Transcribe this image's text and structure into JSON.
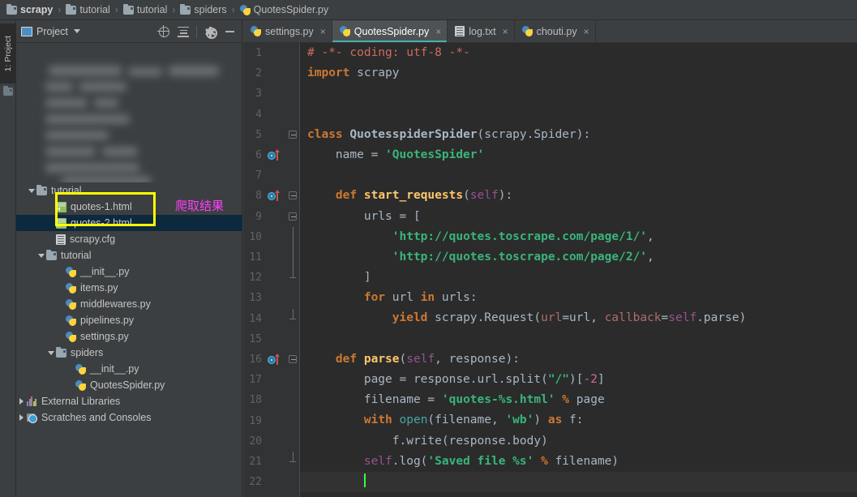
{
  "breadcrumb": [
    {
      "label": "scrapy",
      "icon": "folder-icon"
    },
    {
      "label": "tutorial",
      "icon": "folder-icon"
    },
    {
      "label": "tutorial",
      "icon": "folder-icon"
    },
    {
      "label": "spiders",
      "icon": "folder-icon"
    },
    {
      "label": "QuotesSpider.py",
      "icon": "python-file-icon"
    }
  ],
  "breadcrumb_separator": "›",
  "tool_strip": {
    "project_button": "1: Project"
  },
  "project_panel": {
    "title": "Project",
    "actions": {
      "locate": "select-opened-file",
      "collapse": "collapse-all",
      "settings": "settings",
      "minimize": "hide"
    },
    "tree": [
      {
        "label": "tutorial",
        "icon": "folder-icon",
        "indent": 1,
        "twisty": "down",
        "selected": false
      },
      {
        "label": "quotes-1.html",
        "icon": "html-file-icon",
        "indent": 3,
        "twisty": "none",
        "selected": false
      },
      {
        "label": "quotes-2.html",
        "icon": "html-file-icon",
        "indent": 3,
        "twisty": "none",
        "selected": true
      },
      {
        "label": "scrapy.cfg",
        "icon": "text-file-icon",
        "indent": 3,
        "twisty": "none",
        "selected": false
      },
      {
        "label": "tutorial",
        "icon": "folder-icon",
        "indent": 2,
        "twisty": "down",
        "selected": false
      },
      {
        "label": "__init__.py",
        "icon": "python-file-icon",
        "indent": 4,
        "twisty": "none",
        "selected": false
      },
      {
        "label": "items.py",
        "icon": "python-file-icon",
        "indent": 4,
        "twisty": "none",
        "selected": false
      },
      {
        "label": "middlewares.py",
        "icon": "python-file-icon",
        "indent": 4,
        "twisty": "none",
        "selected": false
      },
      {
        "label": "pipelines.py",
        "icon": "python-file-icon",
        "indent": 4,
        "twisty": "none",
        "selected": false
      },
      {
        "label": "settings.py",
        "icon": "python-file-icon",
        "indent": 4,
        "twisty": "none",
        "selected": false
      },
      {
        "label": "spiders",
        "icon": "folder-icon",
        "indent": 3,
        "twisty": "down",
        "selected": false
      },
      {
        "label": "__init__.py",
        "icon": "python-file-icon",
        "indent": 5,
        "twisty": "none",
        "selected": false
      },
      {
        "label": "QuotesSpider.py",
        "icon": "python-file-icon",
        "indent": 5,
        "twisty": "none",
        "selected": false
      },
      {
        "label": "External Libraries",
        "icon": "library-icon",
        "indent": 0,
        "twisty": "right",
        "selected": false
      },
      {
        "label": "Scratches and Consoles",
        "icon": "scratches-icon",
        "indent": 0,
        "twisty": "right",
        "selected": false
      }
    ],
    "annotation": {
      "text": "爬取结果",
      "box_color": "#ffff00",
      "text_color": "#ff3fff"
    }
  },
  "editor": {
    "tabs": [
      {
        "label": "settings.py",
        "icon": "python-file-icon",
        "active": false,
        "close": "×"
      },
      {
        "label": "QuotesSpider.py",
        "icon": "python-file-icon",
        "active": true,
        "close": "×"
      },
      {
        "label": "log.txt",
        "icon": "text-file-icon",
        "active": false,
        "close": "×"
      },
      {
        "label": "chouti.py",
        "icon": "python-file-icon",
        "active": false,
        "close": "×"
      }
    ],
    "active_tab_underline_color": "#46b0b0",
    "caret_color": "#3aff3a",
    "lines": [
      {
        "num": "1",
        "gutter_run": false,
        "fold": "none",
        "tokens": [
          {
            "t": "comment",
            "v": "# -*- coding: utf-8 -*-"
          }
        ]
      },
      {
        "num": "2",
        "gutter_run": false,
        "fold": "none",
        "tokens": [
          {
            "t": "kw",
            "v": "import"
          },
          {
            "t": "plain",
            "v": " scrapy"
          }
        ]
      },
      {
        "num": "3",
        "gutter_run": false,
        "fold": "none",
        "tokens": []
      },
      {
        "num": "4",
        "gutter_run": false,
        "fold": "none",
        "tokens": []
      },
      {
        "num": "5",
        "gutter_run": false,
        "fold": "minus",
        "tokens": [
          {
            "t": "kw",
            "v": "class"
          },
          {
            "t": "plain",
            "v": " "
          },
          {
            "t": "class",
            "v": "QuotesspiderSpider"
          },
          {
            "t": "op",
            "v": "("
          },
          {
            "t": "plain",
            "v": "scrapy.Spider"
          },
          {
            "t": "op",
            "v": "):"
          }
        ]
      },
      {
        "num": "6",
        "gutter_run": true,
        "fold": "none",
        "tokens": [
          {
            "t": "plain",
            "v": "    name = "
          },
          {
            "t": "str",
            "v": "'QuotesSpider'"
          }
        ]
      },
      {
        "num": "7",
        "gutter_run": false,
        "fold": "none",
        "tokens": []
      },
      {
        "num": "8",
        "gutter_run": true,
        "fold": "minus",
        "tokens": [
          {
            "t": "plain",
            "v": "    "
          },
          {
            "t": "kw",
            "v": "def"
          },
          {
            "t": "plain",
            "v": " "
          },
          {
            "t": "def",
            "v": "start_requests"
          },
          {
            "t": "op",
            "v": "("
          },
          {
            "t": "self",
            "v": "self"
          },
          {
            "t": "op",
            "v": "):"
          }
        ]
      },
      {
        "num": "9",
        "gutter_run": false,
        "fold": "minus",
        "tokens": [
          {
            "t": "plain",
            "v": "        urls = ["
          }
        ]
      },
      {
        "num": "10",
        "gutter_run": false,
        "fold": "line",
        "tokens": [
          {
            "t": "plain",
            "v": "            "
          },
          {
            "t": "str",
            "v": "'http://quotes.toscrape.com/page/1/'"
          },
          {
            "t": "op",
            "v": ","
          }
        ]
      },
      {
        "num": "11",
        "gutter_run": false,
        "fold": "line",
        "tokens": [
          {
            "t": "plain",
            "v": "            "
          },
          {
            "t": "str",
            "v": "'http://quotes.toscrape.com/page/2/'"
          },
          {
            "t": "op",
            "v": ","
          }
        ]
      },
      {
        "num": "12",
        "gutter_run": false,
        "fold": "end",
        "tokens": [
          {
            "t": "plain",
            "v": "        ]"
          }
        ]
      },
      {
        "num": "13",
        "gutter_run": false,
        "fold": "none",
        "tokens": [
          {
            "t": "plain",
            "v": "        "
          },
          {
            "t": "kw",
            "v": "for"
          },
          {
            "t": "plain",
            "v": " url "
          },
          {
            "t": "kw",
            "v": "in"
          },
          {
            "t": "plain",
            "v": " urls:"
          }
        ]
      },
      {
        "num": "14",
        "gutter_run": false,
        "fold": "end",
        "tokens": [
          {
            "t": "plain",
            "v": "            "
          },
          {
            "t": "kw",
            "v": "yield"
          },
          {
            "t": "plain",
            "v": " scrapy.Request("
          },
          {
            "t": "kwarg",
            "v": "url"
          },
          {
            "t": "op",
            "v": "="
          },
          {
            "t": "plain",
            "v": "url, "
          },
          {
            "t": "kwarg",
            "v": "callback"
          },
          {
            "t": "op",
            "v": "="
          },
          {
            "t": "self",
            "v": "self"
          },
          {
            "t": "plain",
            "v": ".parse)"
          }
        ]
      },
      {
        "num": "15",
        "gutter_run": false,
        "fold": "none",
        "tokens": []
      },
      {
        "num": "16",
        "gutter_run": true,
        "fold": "minus",
        "tokens": [
          {
            "t": "plain",
            "v": "    "
          },
          {
            "t": "kw",
            "v": "def"
          },
          {
            "t": "plain",
            "v": " "
          },
          {
            "t": "def",
            "v": "parse"
          },
          {
            "t": "op",
            "v": "("
          },
          {
            "t": "self",
            "v": "self"
          },
          {
            "t": "op",
            "v": ", "
          },
          {
            "t": "plain",
            "v": "response"
          },
          {
            "t": "op",
            "v": "):"
          }
        ]
      },
      {
        "num": "17",
        "gutter_run": false,
        "fold": "none",
        "tokens": [
          {
            "t": "plain",
            "v": "        page = response.url.split("
          },
          {
            "t": "str",
            "v": "\"/\""
          },
          {
            "t": "plain",
            "v": ")["
          },
          {
            "t": "num",
            "v": "-2"
          },
          {
            "t": "plain",
            "v": "]"
          }
        ]
      },
      {
        "num": "18",
        "gutter_run": false,
        "fold": "none",
        "tokens": [
          {
            "t": "plain",
            "v": "        filename = "
          },
          {
            "t": "str",
            "v": "'quotes-%s.html'"
          },
          {
            "t": "plain",
            "v": " "
          },
          {
            "t": "kw",
            "v": "%"
          },
          {
            "t": "plain",
            "v": " page"
          }
        ]
      },
      {
        "num": "19",
        "gutter_run": false,
        "fold": "none",
        "tokens": [
          {
            "t": "plain",
            "v": "        "
          },
          {
            "t": "kw",
            "v": "with"
          },
          {
            "t": "plain",
            "v": " "
          },
          {
            "t": "builtin",
            "v": "open"
          },
          {
            "t": "plain",
            "v": "(filename, "
          },
          {
            "t": "str",
            "v": "'wb'"
          },
          {
            "t": "plain",
            "v": ") "
          },
          {
            "t": "kw",
            "v": "as"
          },
          {
            "t": "plain",
            "v": " f:"
          }
        ]
      },
      {
        "num": "20",
        "gutter_run": false,
        "fold": "none",
        "tokens": [
          {
            "t": "plain",
            "v": "            f.write(response.body)"
          }
        ]
      },
      {
        "num": "21",
        "gutter_run": false,
        "fold": "end",
        "tokens": [
          {
            "t": "plain",
            "v": "        "
          },
          {
            "t": "self",
            "v": "self"
          },
          {
            "t": "plain",
            "v": ".log("
          },
          {
            "t": "str",
            "v": "'Saved file %s'"
          },
          {
            "t": "plain",
            "v": " "
          },
          {
            "t": "kw",
            "v": "%"
          },
          {
            "t": "plain",
            "v": " filename)"
          }
        ]
      },
      {
        "num": "22",
        "gutter_run": false,
        "fold": "none",
        "current": true,
        "caret": true,
        "tokens": []
      }
    ]
  }
}
